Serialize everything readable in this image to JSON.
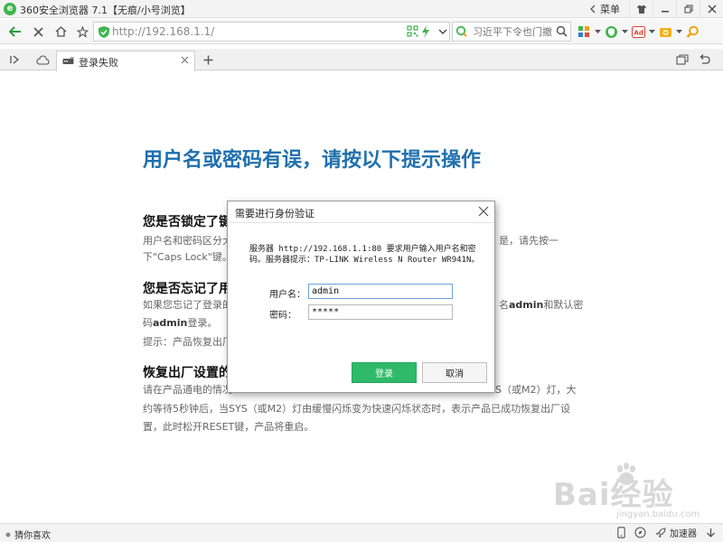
{
  "window": {
    "title": "360安全浏览器 7.1【无痕/小号浏览】",
    "menu_label": "菜单"
  },
  "address": {
    "url": "http://192.168.1.1/"
  },
  "search": {
    "placeholder": "习近平下令也门撤"
  },
  "tab": {
    "label": "登录失败"
  },
  "page": {
    "heading": "用户名或密码有误，请按以下提示操作",
    "sections": [
      {
        "title": "您是否锁定了键",
        "line1_left": "用户名和密码区分大",
        "line1_right": "是，请先按一",
        "line2": "下\"Caps Lock\"键。"
      },
      {
        "title": "您是否忘记了用",
        "line1_left": "如果您忘记了登录的",
        "line1_right_a": "名",
        "line1_right_bold": "admin",
        "line1_right_b": "和默认密",
        "line2_a": "码",
        "line2_bold": "admin",
        "line2_b": "登录。",
        "line3": "提示：产品恢复出厂"
      },
      {
        "title": "恢复出厂设置的",
        "line1_left": "请在产品通电的情况",
        "line1_right": "S（或M2）灯，大",
        "line2": "约等待5秒钟后，当SYS（或M2）灯由缓慢闪烁变为快速闪烁状态时，表示产品已成功恢复出厂设",
        "line3": "置，此时松开RESET键，产品将重启。"
      }
    ]
  },
  "dialog": {
    "title": "需要进行身份验证",
    "message_line1": "服务器 http://192.168.1.1:80 要求用户输入用户名和密",
    "message_line2": "码。服务器提示：TP-LINK Wireless N Router WR941N。",
    "username_label": "用户名：",
    "username_value": "admin",
    "password_label": "密码：",
    "password_value": "*****",
    "login_label": "登录",
    "cancel_label": "取消"
  },
  "statusbar": {
    "left_label": "猜你喜欢",
    "accelerator_label": "加速器"
  },
  "watermark": {
    "logo_text": "Bai经验",
    "sub_text": "jingyan.baidu.com"
  },
  "colors": {
    "heading_blue": "#1f6fad",
    "login_green": "#2fba6a",
    "brand_green": "#3fb54c"
  }
}
